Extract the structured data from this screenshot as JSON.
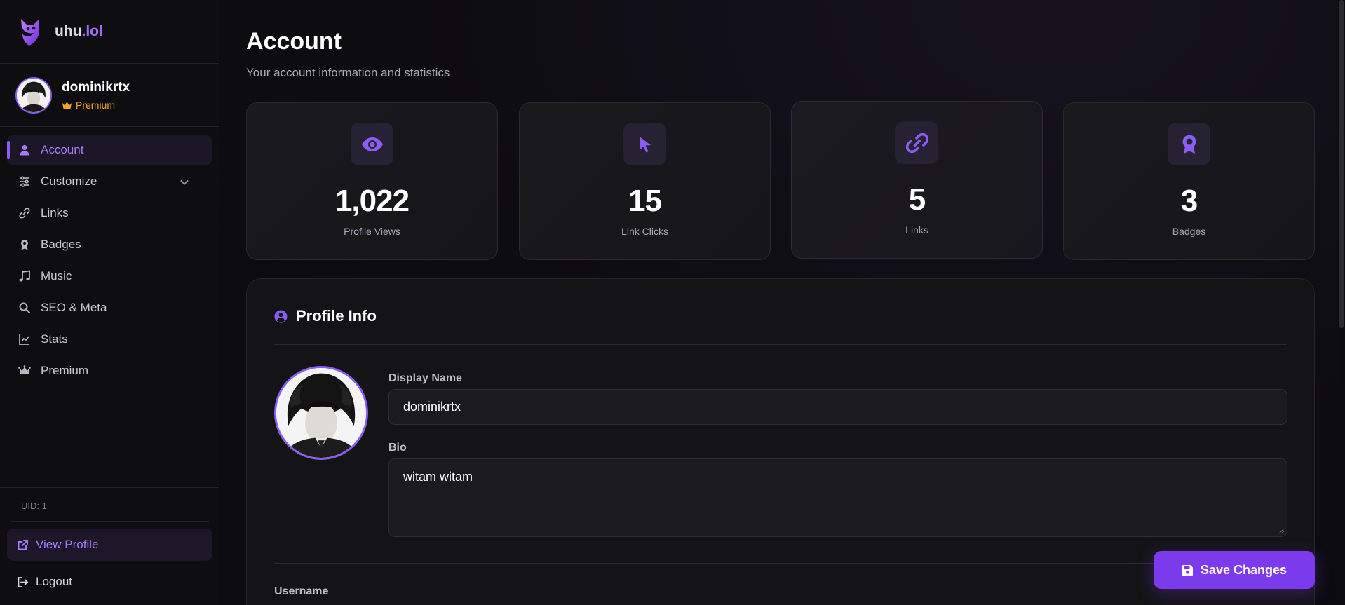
{
  "brand": {
    "name_main": "uhu",
    "name_accent": ".lol"
  },
  "user": {
    "name": "dominikrtx",
    "plan": "Premium",
    "uid": "UID: 1"
  },
  "nav": {
    "items": [
      {
        "label": "Account",
        "icon": "user-icon"
      },
      {
        "label": "Customize",
        "icon": "sliders-icon"
      },
      {
        "label": "Links",
        "icon": "link-icon"
      },
      {
        "label": "Badges",
        "icon": "award-icon"
      },
      {
        "label": "Music",
        "icon": "music-icon"
      },
      {
        "label": "SEO & Meta",
        "icon": "search-icon"
      },
      {
        "label": "Stats",
        "icon": "chart-line-icon"
      },
      {
        "label": "Premium",
        "icon": "crown-icon"
      }
    ],
    "view_profile": "View Profile",
    "logout": "Logout"
  },
  "page": {
    "title": "Account",
    "subtitle": "Your account information and statistics"
  },
  "stats": [
    {
      "value": "1,022",
      "label": "Profile Views",
      "icon": "eye-icon"
    },
    {
      "value": "15",
      "label": "Link Clicks",
      "icon": "cursor-icon"
    },
    {
      "value": "5",
      "label": "Links",
      "icon": "link-icon"
    },
    {
      "value": "3",
      "label": "Badges",
      "icon": "award-icon"
    }
  ],
  "profile_info": {
    "title": "Profile Info",
    "display_name_label": "Display Name",
    "display_name_value": "dominikrtx",
    "bio_label": "Bio",
    "bio_value": "witam witam",
    "username_label": "Username"
  },
  "actions": {
    "save": "Save Changes"
  },
  "colors": {
    "accent": "#8b5cf6",
    "button": "#7c3aed",
    "premium": "#f5a524",
    "background": "#0c0b10"
  }
}
